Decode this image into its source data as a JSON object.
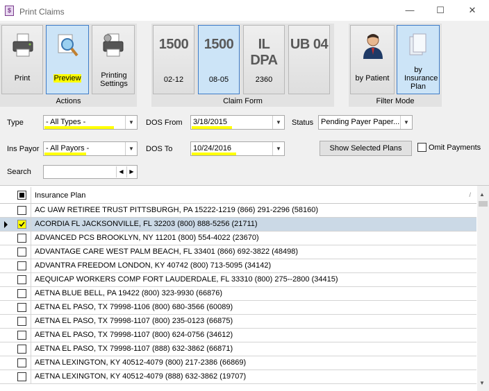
{
  "window": {
    "title": "Print Claims"
  },
  "actions": {
    "group_label": "Actions",
    "print_label": "Print",
    "preview_label": "Preview",
    "settings_label": "Printing Settings"
  },
  "claim_form": {
    "group_label": "Claim Form",
    "forms": [
      {
        "big": "1500",
        "small": "02-12"
      },
      {
        "big": "1500",
        "small": "08-05"
      },
      {
        "big": "IL DPA",
        "small": "2360"
      },
      {
        "big": "UB 04",
        "small": ""
      }
    ]
  },
  "filter_mode": {
    "group_label": "Filter Mode",
    "by_patient_label": "by Patient",
    "by_insurance_label": "by Insurance Plan"
  },
  "filters": {
    "type_label": "Type",
    "type_value": "- All Types -",
    "ins_payor_label": "Ins Payor",
    "ins_payor_value": "- All Payors -",
    "search_label": "Search",
    "dos_from_label": "DOS From",
    "dos_from_value": "3/18/2015",
    "dos_to_label": "DOS To",
    "dos_to_value": "10/24/2016",
    "status_label": "Status",
    "status_value": "Pending Payer Paper...",
    "show_selected_label": "Show Selected Plans",
    "omit_payments_label": "Omit Payments"
  },
  "grid": {
    "column_header": "Insurance Plan",
    "rows": [
      "AC UAW RETIREE TRUST PITTSBURGH, PA 15222-1219 (866) 291-2296 (58160)",
      "ACORDIA FL JACKSONVILLE, FL 32203 (800) 888-5256 (21711)",
      "ADVANCED PCS BROOKLYN, NY 11201 (800) 554-4022 (23670)",
      "ADVANTAGE CARE WEST PALM BEACH, FL 33401 (866) 692-3822 (48498)",
      "ADVANTRA FREEDOM LONDON, KY 40742 (800) 713-5095 (34142)",
      "AEQUICAP WORKERS COMP FORT LAUDERDALE, FL 33310 (800) 275--2800 (34415)",
      "AETNA BLUE BELL, PA 19422 (800) 323-9930 (66876)",
      "AETNA EL PASO, TX 79998-1106 (800) 680-3566 (60089)",
      "AETNA EL PASO, TX 79998-1107 (800) 235-0123 (66875)",
      "AETNA EL PASO, TX 79998-1107 (800) 624-0756 (34612)",
      "AETNA EL PASO, TX 79998-1107 (888) 632-3862 (66871)",
      "AETNA LEXINGTON, KY 40512-4079 (800) 217-2386 (66869)",
      "AETNA LEXINGTON, KY 40512-4079 (888) 632-3862 (19707)"
    ],
    "selected_row_index": 1
  }
}
